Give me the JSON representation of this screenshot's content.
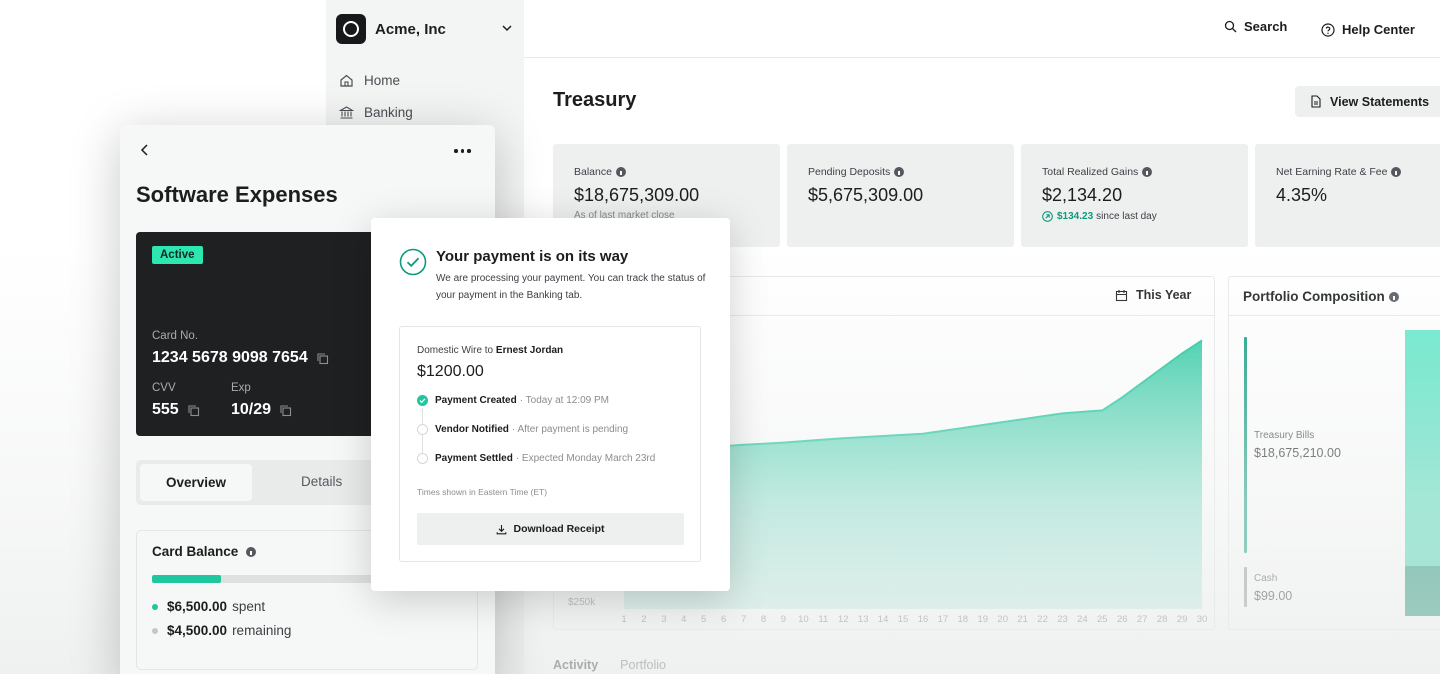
{
  "sidebar": {
    "org_name": "Acme, Inc",
    "items": [
      {
        "label": "Home",
        "icon": "home-icon"
      },
      {
        "label": "Banking",
        "icon": "bank-icon"
      }
    ]
  },
  "topbar": {
    "search_label": "Search",
    "help_label": "Help Center"
  },
  "treasury": {
    "title": "Treasury",
    "view_statements_label": "View Statements",
    "stats": [
      {
        "label": "Balance",
        "value": "$18,675,309.00",
        "sub": "As of last market close"
      },
      {
        "label": "Pending Deposits",
        "value": "$5,675,309.00"
      },
      {
        "label": "Total Realized Gains",
        "value": "$2,134.20",
        "gain": "$134.23",
        "gain_suffix": "since last day"
      },
      {
        "label": "Net Earning Rate & Fee",
        "value": "4.35%"
      }
    ],
    "range_label": "This Year",
    "bottom_tabs": [
      "Activity",
      "Portfolio"
    ]
  },
  "chart_data": {
    "type": "area",
    "x": [
      1,
      2,
      3,
      4,
      5,
      6,
      7,
      8,
      9,
      10,
      11,
      12,
      13,
      14,
      15,
      16,
      17,
      18,
      19,
      20,
      21,
      22,
      23,
      24,
      25,
      26,
      27,
      28,
      29,
      30
    ],
    "values": [
      1900,
      2010,
      2120,
      2180,
      2210,
      2230,
      2250,
      2265,
      2280,
      2300,
      2320,
      2340,
      2355,
      2370,
      2385,
      2400,
      2440,
      2480,
      2520,
      2560,
      2600,
      2640,
      2680,
      2700,
      2720,
      2900,
      3100,
      3300,
      3500,
      3680
    ],
    "y_tick_labels": [
      "$250k"
    ],
    "xlabel": "",
    "ylabel": "",
    "ylim": [
      0,
      4000
    ],
    "color": "#1ec79d"
  },
  "portfolio": {
    "title": "Portfolio Composition",
    "items": [
      {
        "label": "Treasury Bills",
        "value": "$18,675,210.00"
      },
      {
        "label": "Cash",
        "value": "$99.00"
      }
    ]
  },
  "card_panel": {
    "title": "Software Expenses",
    "status": "Active",
    "card_no_label": "Card No.",
    "card_no": "1234 5678 9098 7654",
    "cvv_label": "CVV",
    "cvv": "555",
    "exp_label": "Exp",
    "exp": "10/29",
    "tabs": [
      "Overview",
      "Details"
    ],
    "balance": {
      "title": "Card Balance",
      "spent_fraction": 0.3,
      "spent": "$6,500.00",
      "spent_label": "spent",
      "remaining": "$4,500.00",
      "remaining_label": "remaining"
    }
  },
  "modal": {
    "title": "Your payment is on its way",
    "description": "We are processing your payment. You can track the status of your payment in the Banking tab.",
    "transfer_prefix": "Domestic Wire to",
    "recipient": "Ernest Jordan",
    "amount": "$1200.00",
    "steps": [
      {
        "label": "Payment Created",
        "detail": "· Today at 12:09 PM",
        "done": true
      },
      {
        "label": "Vendor Notified",
        "detail": "· After payment is pending",
        "done": false
      },
      {
        "label": "Payment Settled",
        "detail": "· Expected Monday March 23rd",
        "done": false
      }
    ],
    "timezone_note": "Times shown in Eastern Time (ET)",
    "download_label": "Download Receipt"
  },
  "colors": {
    "accent": "#1ec79d",
    "accent_dark": "#0d9a7a",
    "card_bg": "#1e2022"
  }
}
